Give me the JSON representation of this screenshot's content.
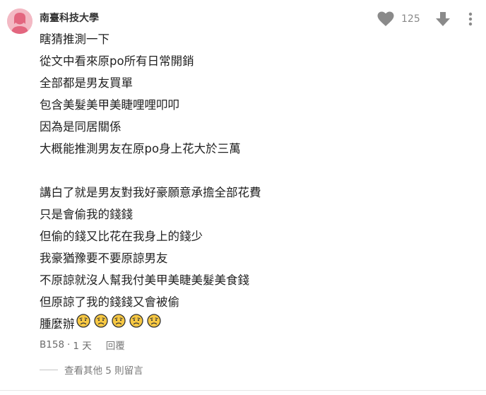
{
  "comment": {
    "author": "南臺科技大學",
    "likes": "125",
    "lines": [
      "瞎猜推測一下",
      "從文中看來原po所有日常開銷",
      "全部都是男友買單",
      "包含美髮美甲美睫哩哩叩叩",
      "因為是同居關係",
      "大概能推測男友在原po身上花大於三萬",
      "",
      "講白了就是男友對我好豪願意承擔全部花費",
      "只是會偷我的錢錢",
      "但偷的錢又比花在我身上的錢少",
      "我豪猶豫要不要原諒男友",
      "不原諒就沒人幫我付美甲美睫美髮美食錢",
      "但原諒了我的錢錢又會被偷"
    ],
    "last_line_text": "腫麼辦",
    "emoji_name": "worried-face-emoji",
    "emoji_count": 5,
    "floor": "B158",
    "separator": "·",
    "time": "1 天",
    "reply_label": "回覆",
    "more_replies_label": "查看其他 5 則留言"
  },
  "colors": {
    "avatar_bg": "#f3b9c4",
    "avatar_fg": "#e3667f",
    "icon_gray": "#8a8a8a",
    "emoji_face": "#f7c843"
  },
  "icons": [
    "heart-icon",
    "thumb-down-arrow-icon",
    "more-vertical-icon"
  ]
}
